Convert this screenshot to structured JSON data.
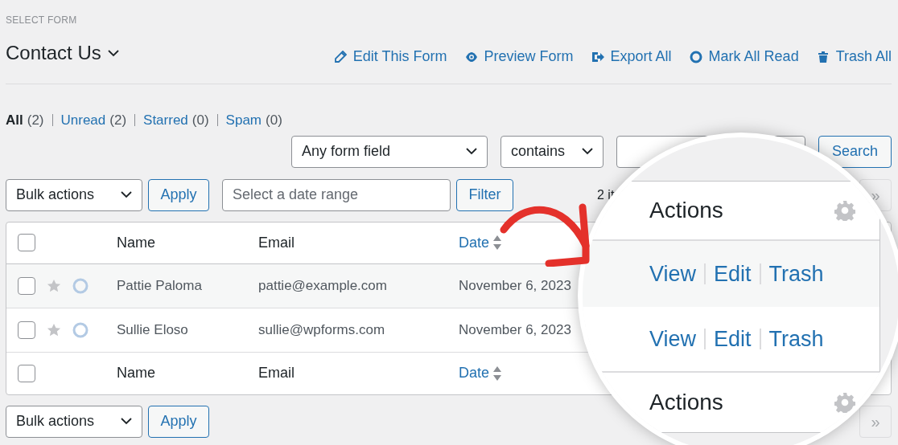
{
  "form_selector": {
    "label": "SELECT FORM",
    "value": "Contact Us"
  },
  "actions": [
    {
      "kind": "pencil",
      "label": "Edit This Form"
    },
    {
      "kind": "eye",
      "label": "Preview Form"
    },
    {
      "kind": "export",
      "label": "Export All"
    },
    {
      "kind": "circle",
      "label": "Mark All Read"
    },
    {
      "kind": "trash",
      "label": "Trash All"
    }
  ],
  "views": [
    {
      "label": "All",
      "count": "(2)",
      "selected": true
    },
    {
      "label": "Unread",
      "count": "(2)",
      "selected": false
    },
    {
      "label": "Starred",
      "count": "(0)",
      "selected": false
    },
    {
      "label": "Spam",
      "count": "(0)",
      "selected": false
    }
  ],
  "search": {
    "field": "Any form field",
    "operator": "contains",
    "button": "Search"
  },
  "top_bar": {
    "bulk_actions": "Bulk actions",
    "apply": "Apply",
    "date_placeholder": "Select a date range",
    "filter": "Filter",
    "item_count": "2 it",
    "last_page": "»"
  },
  "table": {
    "select_all_checked": false,
    "columns": [
      {
        "label": "Name",
        "kind": "plain"
      },
      {
        "label": "Email",
        "kind": "plain"
      },
      {
        "label": "Date",
        "kind": "sortable"
      }
    ],
    "rows": [
      {
        "name": "Pattie Paloma",
        "email": "pattie@example.com",
        "date": "November 6, 2023",
        "selected": false,
        "starred": false,
        "read": false
      },
      {
        "name": "Sullie Eloso",
        "email": "sullie@wpforms.com",
        "date": "November 6, 2023",
        "selected": false,
        "starred": false,
        "read": false
      }
    ],
    "footer_select_all_checked": false,
    "footer_columns": [
      {
        "label": "Name",
        "kind": "plain"
      },
      {
        "label": "Email",
        "kind": "plain"
      },
      {
        "label": "Date",
        "kind": "sortable"
      }
    ]
  },
  "bottom_bar": {
    "bulk_actions": "Bulk actions",
    "apply": "Apply",
    "last_page": "»"
  },
  "magnifier": {
    "header": "Actions",
    "rows": [
      {
        "links": [
          "View",
          "Edit",
          "Trash"
        ]
      },
      {
        "links": [
          "View",
          "Edit",
          "Trash"
        ]
      }
    ],
    "footer": "Actions"
  }
}
